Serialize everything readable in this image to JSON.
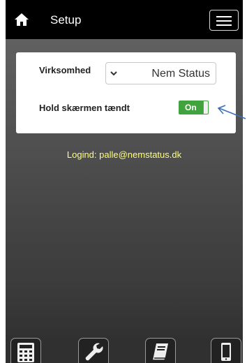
{
  "header": {
    "title": "Setup"
  },
  "settings": {
    "company_label": "Virksomhed",
    "company_value": "Nem Status",
    "screen_on_label": "Hold skærmen tændt",
    "screen_on_state": "On"
  },
  "login_text": "Logind: palle@nemstatus.dk",
  "tabbar": {
    "items": [
      {
        "icon": "calculator-icon"
      },
      {
        "icon": "wrench-icon"
      },
      {
        "icon": "book-icon"
      },
      {
        "icon": "phone-icon"
      }
    ]
  },
  "colors": {
    "toggle_on": "#41a33e",
    "login_text": "#ffff80",
    "header_bg": "#000000",
    "annotation_arrow": "#3a6fb5"
  }
}
